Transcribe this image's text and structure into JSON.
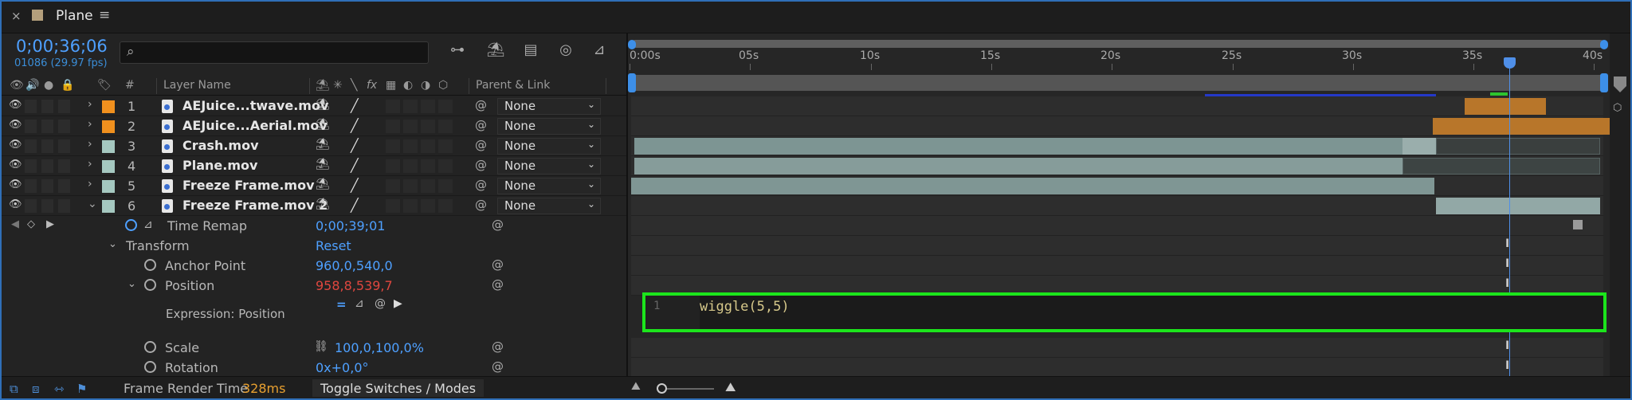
{
  "tab": {
    "close": "×",
    "title": "Plane",
    "menu": "≡"
  },
  "header": {
    "timecode": "0;00;36;06",
    "frame_info": "01086 (29.97 fps)",
    "search_placeholder": ""
  },
  "columns": {
    "hash": "#",
    "layer_name": "Layer Name",
    "parent_link": "Parent & Link",
    "fx": "fx"
  },
  "layers": [
    {
      "num": "1",
      "name": "AEJuice...twave.mov",
      "label_color": "#f0901e",
      "parent": "None"
    },
    {
      "num": "2",
      "name": "AEJuice...Aerial.mov",
      "label_color": "#f0901e",
      "parent": "None"
    },
    {
      "num": "3",
      "name": "Crash.mov",
      "label_color": "#a5c8c0",
      "parent": "None"
    },
    {
      "num": "4",
      "name": "Plane.mov",
      "label_color": "#a5c8c0",
      "parent": "None"
    },
    {
      "num": "5",
      "name": "Freeze Frame.mov",
      "label_color": "#a5c8c0",
      "parent": "None"
    },
    {
      "num": "6",
      "name": "Freeze Frame.mov 2",
      "label_color": "#a5c8c0",
      "parent": "None"
    }
  ],
  "properties": {
    "time_remap": {
      "label": "Time Remap",
      "value": "0;00;39;01"
    },
    "transform": {
      "label": "Transform",
      "value": "Reset"
    },
    "anchor": {
      "label": "Anchor Point",
      "value": "960,0,540,0"
    },
    "position": {
      "label": "Position",
      "value": "958,8,539,7"
    },
    "expression": {
      "label": "Expression: Position"
    },
    "scale": {
      "label": "Scale",
      "value": "100,0,100,0%"
    },
    "rotation": {
      "label": "Rotation",
      "value": "0x+0,0°"
    }
  },
  "timeline": {
    "ticks": [
      "0:00s",
      "05s",
      "10s",
      "15s",
      "20s",
      "25s",
      "30s",
      "35s",
      "40s"
    ]
  },
  "expression_editor": {
    "line_number": "1",
    "code": "wiggle(5,5)"
  },
  "bottom": {
    "render_label": "Frame Render Time",
    "render_value": "328ms",
    "toggle": "Toggle Switches / Modes"
  },
  "colors": {
    "accent": "#4ea0ff",
    "highlight_box": "#1ce51c",
    "orange_clip": "#b8762a",
    "teal_clip": "#7f9896",
    "position_value": "#e0473f"
  }
}
